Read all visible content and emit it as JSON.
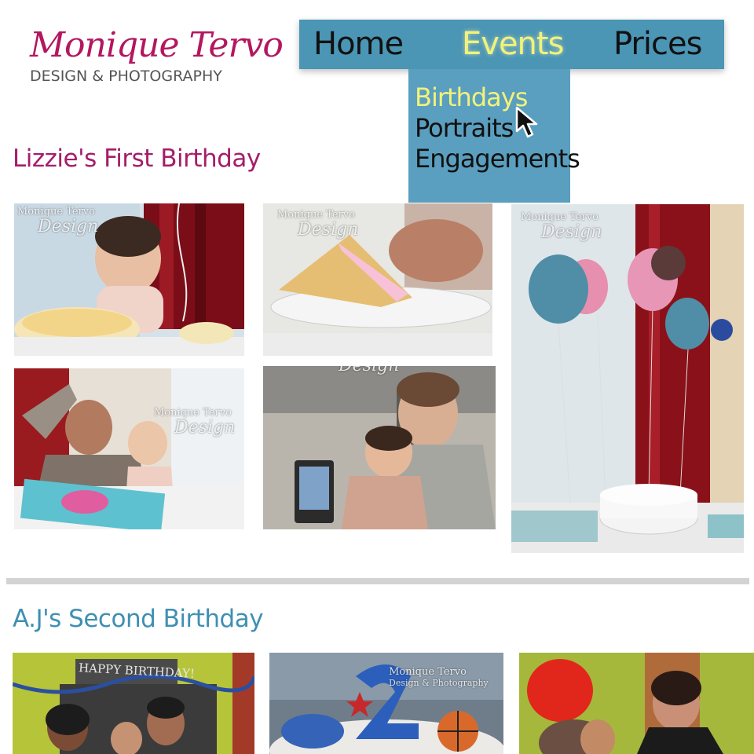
{
  "logo": {
    "script": "Monique Tervo",
    "sub": "DESIGN & PHOTOGRAPHY"
  },
  "nav": {
    "items": [
      "Home",
      "Events",
      "Prices"
    ],
    "active": "Events"
  },
  "dropdown": {
    "items": [
      "Birthdays",
      "Portraits",
      "Engagements"
    ],
    "active": "Birthdays"
  },
  "sections": [
    {
      "title": "Lizzie's First Birthday"
    },
    {
      "title": "A.J's Second Birthday"
    }
  ],
  "watermark": {
    "line1": "Monique Tervo",
    "line2": "Design",
    "line2_full": "Design & Photography"
  },
  "photo_text": {
    "chalkboard": "HAPPY BIRTHDAY!",
    "cake_number": "2"
  },
  "colors": {
    "nav_bg": "#4b95b5",
    "dropdown_bg": "#5a9fbf",
    "active_nav": "#f2f27a",
    "logo_pink": "#b3175f",
    "title_pink": "#a51d6a",
    "title_blue": "#3f8fb3",
    "divider": "#d3d3d3"
  },
  "icons": {
    "cursor": "arrow-cursor-icon"
  }
}
